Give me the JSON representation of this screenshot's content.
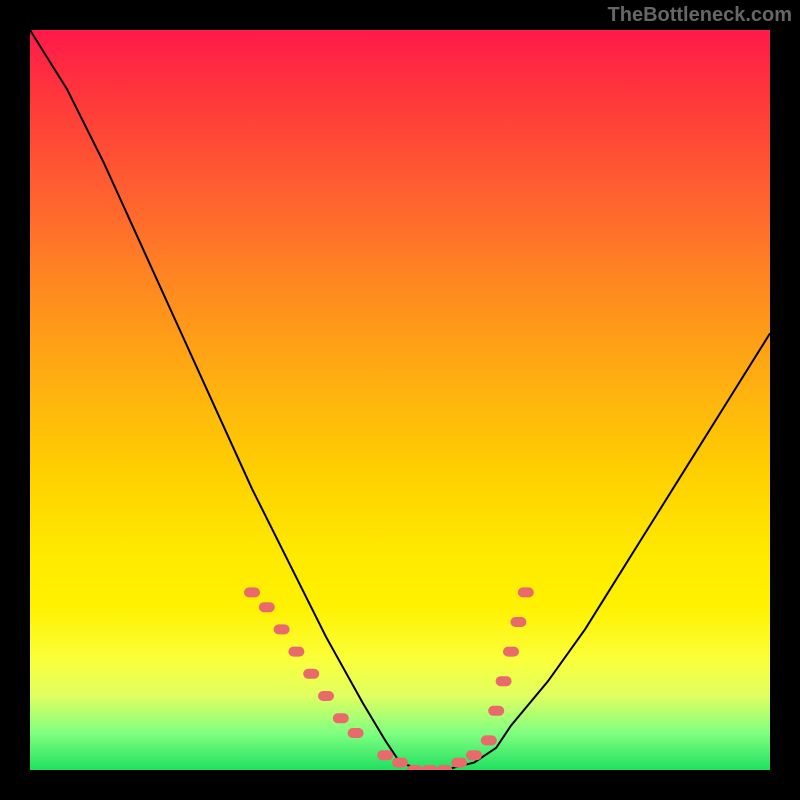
{
  "watermark": "TheBottleneck.com",
  "chart_data": {
    "type": "line",
    "title": "",
    "xlabel": "",
    "ylabel": "",
    "xlim": [
      0,
      100
    ],
    "ylim": [
      0,
      100
    ],
    "x": [
      0,
      5,
      10,
      15,
      20,
      25,
      30,
      35,
      40,
      45,
      48,
      50,
      53,
      56,
      60,
      63,
      65,
      70,
      75,
      80,
      85,
      90,
      95,
      100
    ],
    "values": [
      100,
      92,
      82,
      71,
      60,
      49,
      38,
      28,
      18,
      9,
      4,
      1,
      0,
      0,
      1,
      3,
      6,
      12,
      19,
      27,
      35,
      43,
      51,
      59
    ],
    "marker_points_x": [
      30,
      32,
      34,
      36,
      38,
      40,
      42,
      44,
      48,
      50,
      52,
      54,
      56,
      58,
      60,
      62,
      63,
      64,
      65,
      66,
      67
    ],
    "marker_points_y": [
      24,
      22,
      19,
      16,
      13,
      10,
      7,
      5,
      2,
      1,
      0,
      0,
      0,
      1,
      2,
      4,
      8,
      12,
      16,
      20,
      24
    ],
    "marker_color": "#e86a6a",
    "line_color": "#000000",
    "gradient_stops": [
      "#ff1a4a",
      "#ffd000",
      "#20e060"
    ]
  }
}
